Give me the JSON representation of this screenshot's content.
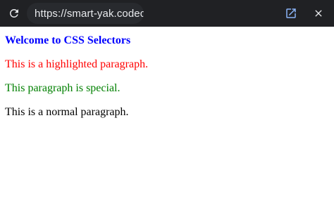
{
  "browser": {
    "url": "https://smart-yak.codec",
    "icons": {
      "reload": "reload-icon",
      "open_in_new_tab": "open-in-new-tab-icon",
      "close": "close-icon"
    },
    "colors": {
      "toolbar_background": "#202124",
      "url_field_background": "#282a2e",
      "open_tab_icon": "#8ab4f8",
      "icon_light": "#e8eaed"
    }
  },
  "page": {
    "heading": "Welcome to CSS Selectors",
    "paragraphs": {
      "highlighted": "This is a highlighted paragraph.",
      "special": "This paragraph is special.",
      "normal": "This is a normal paragraph."
    },
    "colors": {
      "heading": "#0000ff",
      "highlighted": "#ff0000",
      "special": "#008000",
      "normal": "#000000"
    }
  }
}
